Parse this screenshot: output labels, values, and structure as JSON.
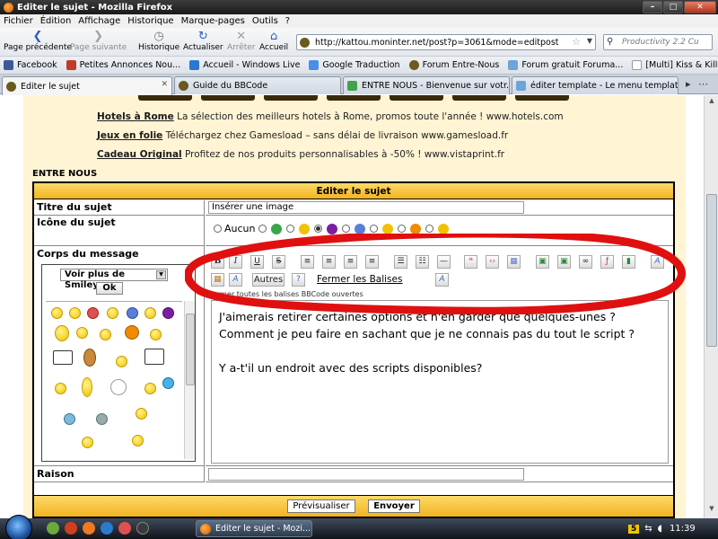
{
  "window": {
    "title": "Editer le sujet - Mozilla Firefox",
    "controls": [
      "–",
      "□",
      "✕"
    ]
  },
  "menu": [
    "Fichier",
    "Édition",
    "Affichage",
    "Historique",
    "Marque-pages",
    "Outils",
    "?"
  ],
  "nav": {
    "back": "Page précédente",
    "forward": "Page suivante",
    "history": "Historique",
    "reload": "Actualiser",
    "stop": "Arrêter",
    "home": "Accueil",
    "url": "http://kattou.moninter.net/post?p=3061&mode=editpost",
    "search_placeholder": "Productivity 2.2 Cu"
  },
  "bookmarks": [
    "Facebook",
    "Petites Annonces Nou...",
    "Accueil - Windows Live",
    "Google Traduction",
    "Forum Entre-Nous",
    "Forum gratuit Foruma...",
    "[Multi] Kiss & Kill [TRU..."
  ],
  "tabs": [
    "Editer le sujet",
    "Guide du BBCode",
    "ENTRE NOUS - Bienvenue sur votr...",
    "éditer template - Le menu templat..."
  ],
  "ads": [
    {
      "link": "Hotels à Rome",
      "text": " La sélection des meilleurs hotels à Rome, promos toute l'année ! www.hotels.com"
    },
    {
      "link": "Jeux en folie",
      "text": " Téléchargez chez Gamesload – sans délai de livraison www.gamesload.fr"
    },
    {
      "link": "Cadeau Original",
      "text": " Profitez de nos produits personnalisables à -50% ! www.vistaprint.fr"
    }
  ],
  "section": "ENTRE NOUS",
  "form": {
    "header": "Editer le sujet",
    "subject_label": "Titre du sujet",
    "subject_value": "Insérer une image",
    "icon_label": "Icône du sujet",
    "icon_none": "Aucun",
    "body_label": "Corps du message",
    "reason_label": "Raison",
    "preview_button": "Prévisualiser",
    "send_button": "Envoyer"
  },
  "toolbar": {
    "bold": "B",
    "italic": "I",
    "underline": "U",
    "strike": "S",
    "others_button": "Autres",
    "close_tags_link": "Fermer les Balises",
    "close_tags_hint": "Fermer toutes les balises BBCode ouvertes"
  },
  "smilies": {
    "select_value": "Voir plus de Smileys",
    "ok_button": "Ok"
  },
  "message_lines": [
    "J'aimerais retirer certaines options et n'en garder que quelques-unes ?",
    "Comment je peu faire en sachant que je ne connais pas du tout le script ?",
    "",
    "Y a-t'il un endroit avec des scripts disponibles?"
  ],
  "taskbar": {
    "task": "Editer le sujet - Mozi...",
    "badge": "5",
    "clock": "11:39"
  },
  "colors": {
    "page_bg": "#fff4d4",
    "header_gold": "#f3b420",
    "annotation_red": "#e01010"
  }
}
